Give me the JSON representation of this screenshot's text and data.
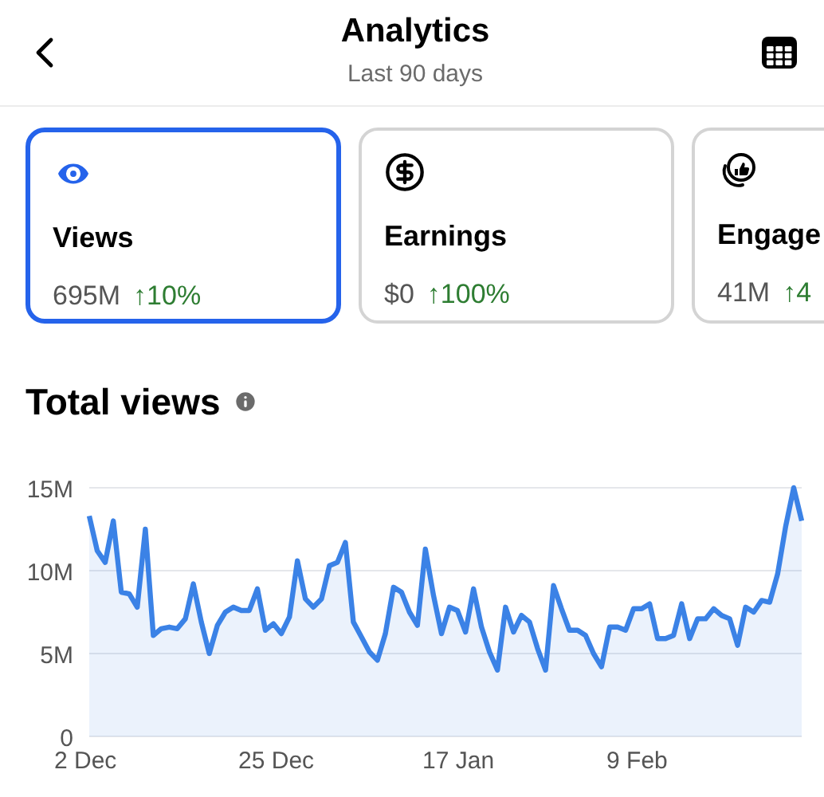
{
  "header": {
    "title": "Analytics",
    "subtitle": "Last 90 days"
  },
  "metrics": [
    {
      "label": "Views",
      "value": "695M",
      "change": "↑10%",
      "selected": true
    },
    {
      "label": "Earnings",
      "value": "$0",
      "change": "↑100%",
      "selected": false
    },
    {
      "label": "Engage",
      "value": "41M",
      "change": "↑4",
      "selected": false
    }
  ],
  "section": {
    "title": "Total views",
    "chart_data": {
      "type": "area",
      "categories": [
        "2 Dec",
        null,
        null,
        null,
        null,
        null,
        null,
        null,
        null,
        null,
        null,
        null,
        null,
        null,
        null,
        null,
        null,
        null,
        null,
        null,
        null,
        null,
        null,
        "25 Dec",
        null,
        null,
        null,
        null,
        null,
        null,
        null,
        null,
        null,
        null,
        null,
        null,
        null,
        null,
        null,
        null,
        null,
        null,
        null,
        null,
        null,
        null,
        "17 Jan",
        null,
        null,
        null,
        null,
        null,
        null,
        null,
        null,
        null,
        null,
        null,
        null,
        null,
        null,
        null,
        null,
        null,
        null,
        null,
        null,
        null,
        null,
        "9 Feb",
        null,
        null,
        null,
        null,
        null,
        null,
        null,
        null,
        null,
        null,
        null,
        null,
        null,
        null,
        null,
        null,
        null,
        null,
        null,
        null
      ],
      "series": [
        {
          "color": "#3b82e6",
          "values": [
            13.3,
            11.2,
            10.5,
            13.0,
            8.7,
            8.6,
            7.8,
            12.5,
            6.1,
            6.5,
            6.6,
            6.5,
            7.1,
            9.2,
            6.9,
            5.0,
            6.7,
            7.5,
            7.8,
            7.6,
            7.6,
            8.9,
            6.4,
            6.8,
            6.2,
            7.2,
            10.6,
            8.3,
            7.8,
            8.3,
            10.3,
            10.5,
            11.7,
            6.9,
            6.0,
            5.1,
            4.6,
            6.2,
            9.0,
            8.7,
            7.5,
            6.7,
            11.3,
            8.5,
            6.2,
            7.8,
            7.6,
            6.3,
            8.9,
            6.6,
            5.1,
            4.0,
            7.8,
            6.3,
            7.3,
            6.9,
            5.3,
            4.0,
            9.1,
            7.7,
            6.4,
            6.4,
            6.1,
            5.0,
            4.2,
            6.6,
            6.6,
            6.4,
            7.7,
            7.7,
            8.0,
            5.9,
            5.9,
            6.1,
            8.0,
            5.9,
            7.1,
            7.1,
            7.7,
            7.3,
            7.1,
            5.5,
            7.8,
            7.5,
            8.2,
            8.1,
            9.8,
            12.7,
            15.0,
            13.0
          ]
        }
      ],
      "ylim": [
        0,
        15
      ],
      "yticks": [
        {
          "value": 0,
          "label": "0"
        },
        {
          "value": 5,
          "label": "5M"
        },
        {
          "value": 10,
          "label": "10M"
        },
        {
          "value": 15,
          "label": "15M"
        }
      ]
    }
  }
}
